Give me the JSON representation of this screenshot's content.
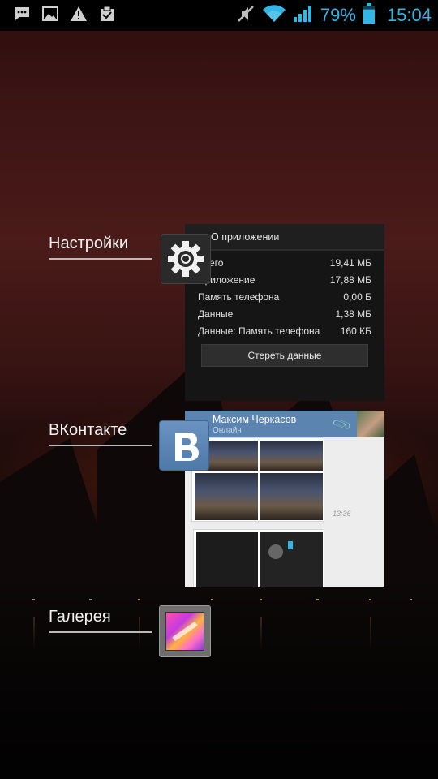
{
  "status_bar": {
    "icons_left": [
      "message-icon",
      "image-icon",
      "warning-icon",
      "clipboard-check-icon"
    ],
    "icons_right": [
      "mute-icon",
      "wifi-icon",
      "signal-icon",
      "battery-icon"
    ],
    "battery_percent": "79%",
    "battery_level": 0.79,
    "time": "15:04",
    "accent_color": "#33b5e5"
  },
  "recent_apps": [
    {
      "label": "Настройки",
      "icon": "gear-icon",
      "thumbnail": {
        "title": "О приложении",
        "rows": [
          {
            "key": "Всего",
            "value": "19,41 МБ"
          },
          {
            "key": "Приложение",
            "value": "17,88 МБ"
          },
          {
            "key": "Память телефона",
            "value": "0,00 Б"
          },
          {
            "key": "Данные",
            "value": "1,38 МБ"
          },
          {
            "key": "Данные: Память телефона",
            "value": "160 КБ"
          }
        ],
        "button": "Стереть данные"
      }
    },
    {
      "label": "ВКонтакте",
      "icon": "vk-logo-icon",
      "thumbnail": {
        "contact_name": "Максим Черкасов",
        "contact_status": "Онлайн",
        "message_time": "13:36",
        "header_color": "#5b84b1"
      }
    },
    {
      "label": "Галерея",
      "icon": "gallery-icon"
    }
  ]
}
